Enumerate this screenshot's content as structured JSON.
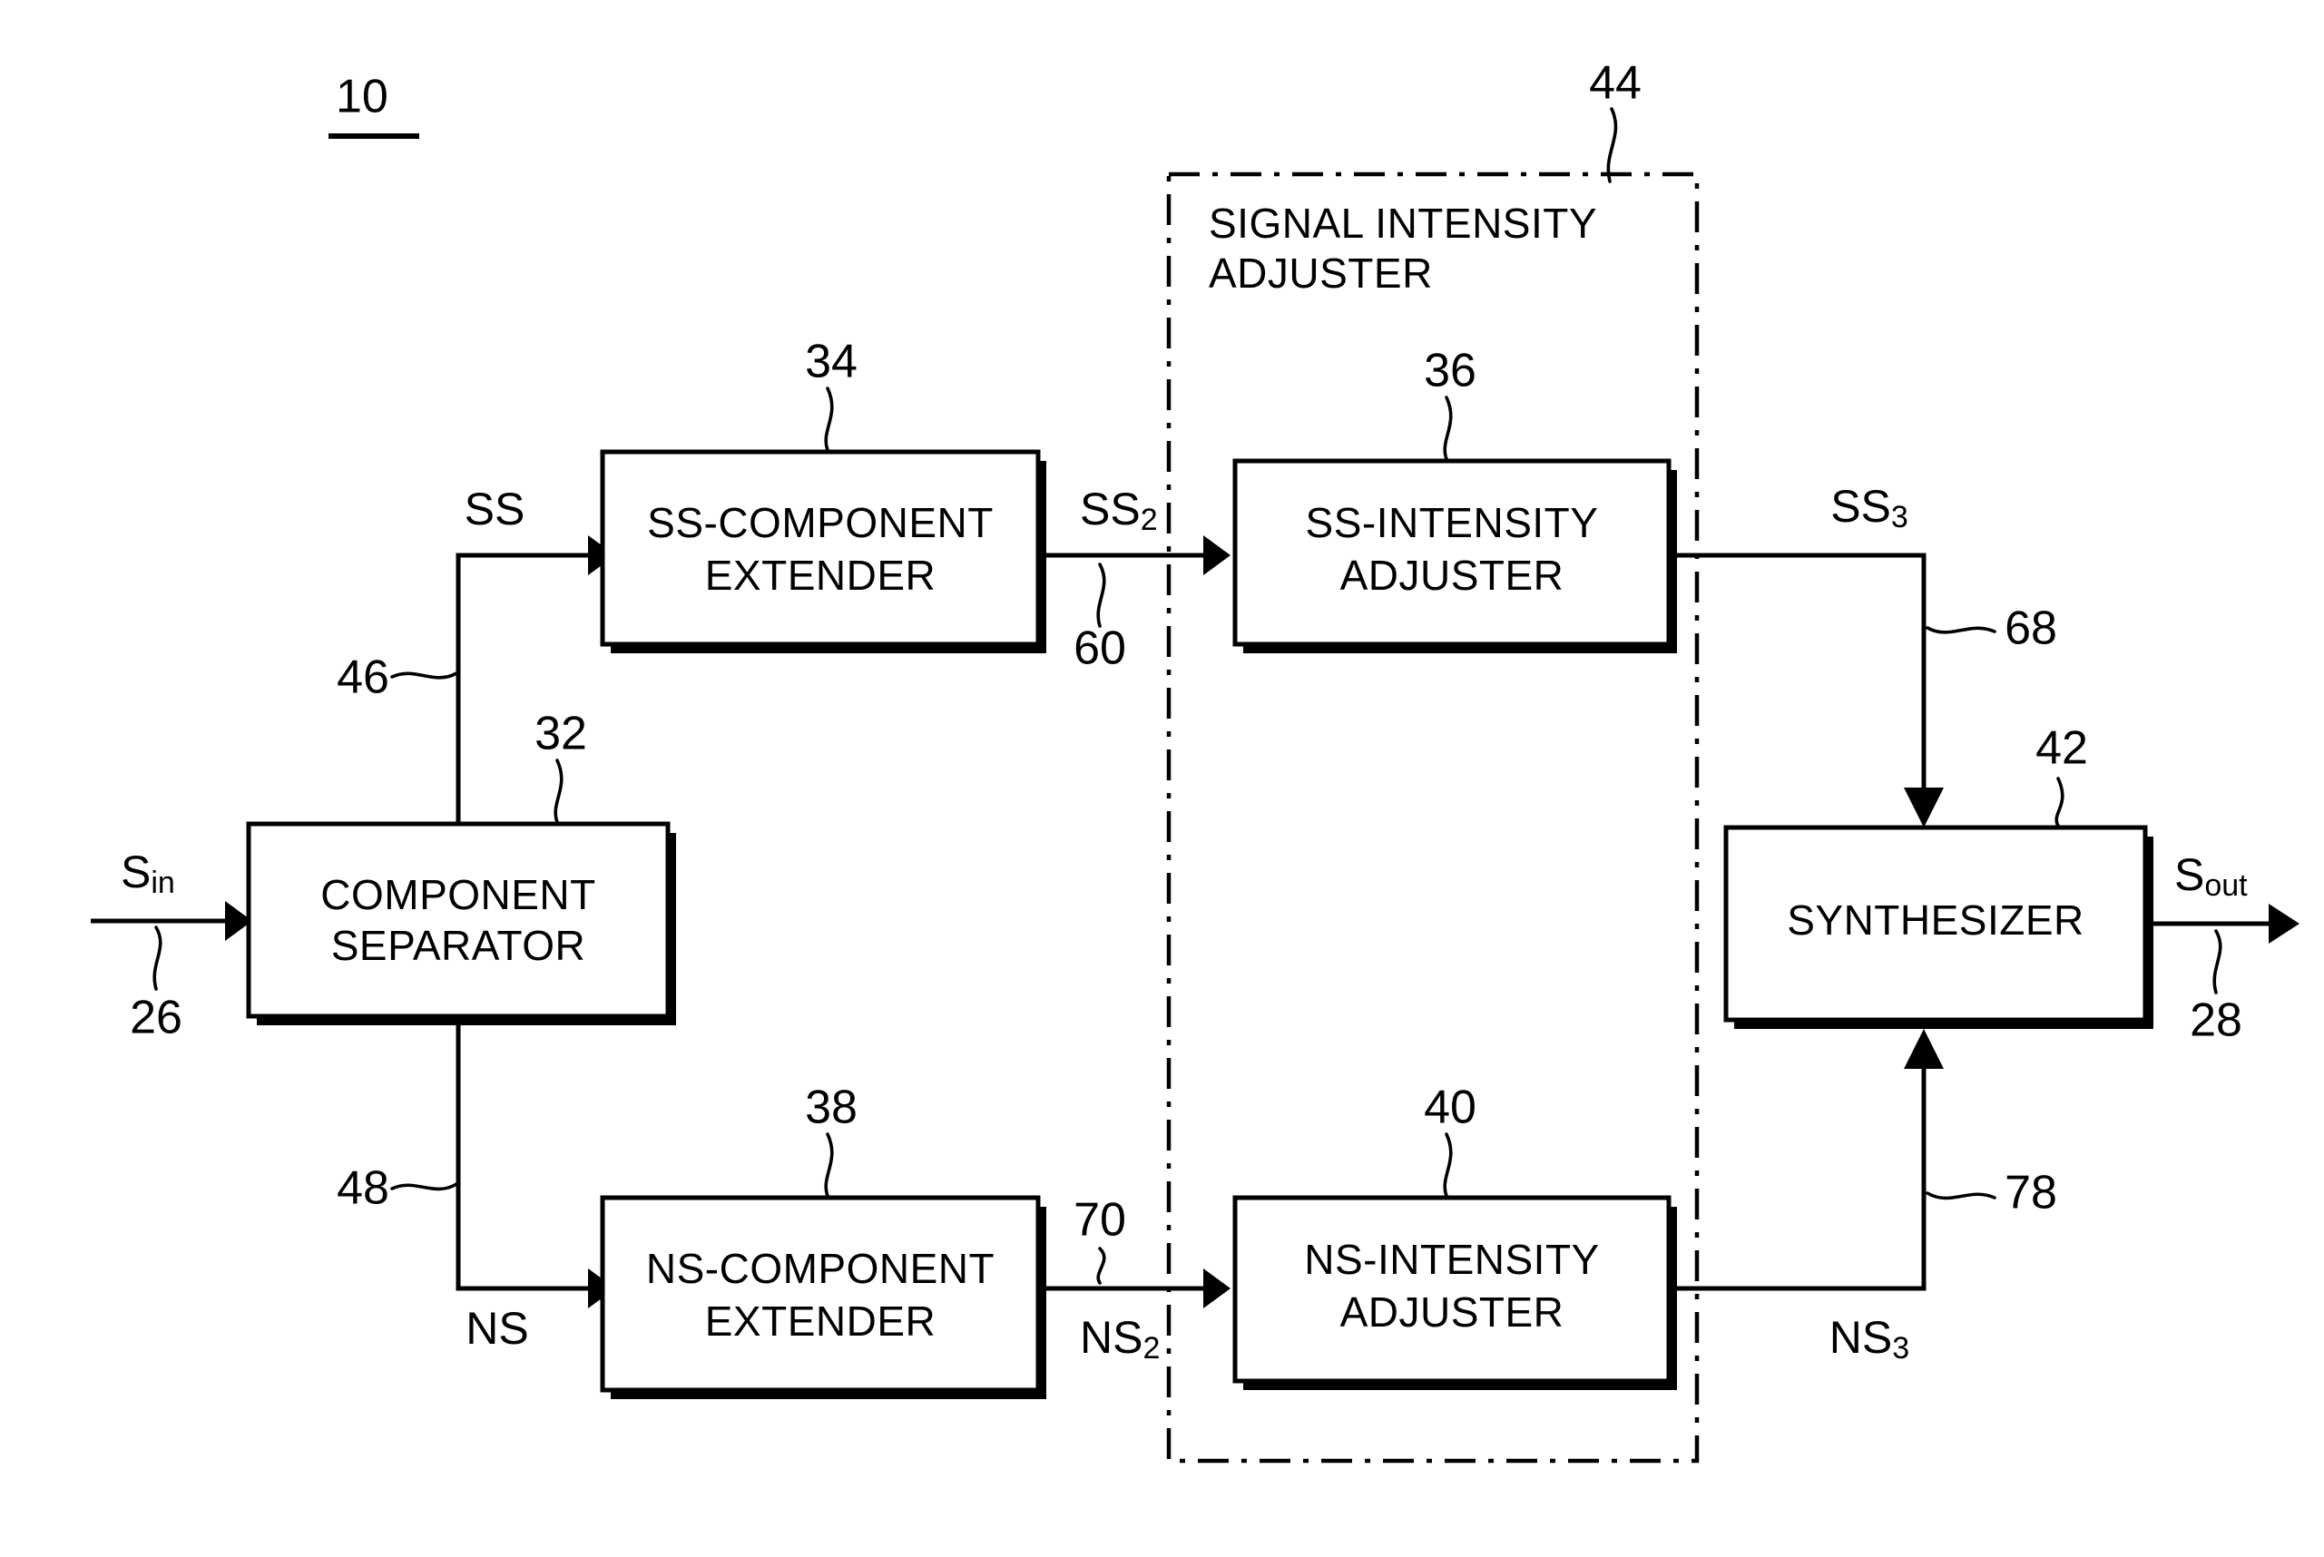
{
  "figure": {
    "number": "10",
    "underlined": true
  },
  "blocks": [
    {
      "id": "component-separator",
      "ref": "32",
      "lines": [
        "COMPONENT",
        "SEPARATOR"
      ]
    },
    {
      "id": "ss-component-extender",
      "ref": "34",
      "lines": [
        "SS-COMPONENT",
        "EXTENDER"
      ]
    },
    {
      "id": "ss-intensity-adjuster",
      "ref": "36",
      "lines": [
        "SS-INTENSITY",
        "ADJUSTER"
      ]
    },
    {
      "id": "ns-component-extender",
      "ref": "38",
      "lines": [
        "NS-COMPONENT",
        "EXTENDER"
      ]
    },
    {
      "id": "ns-intensity-adjuster",
      "ref": "40",
      "lines": [
        "NS-INTENSITY",
        "ADJUSTER"
      ]
    },
    {
      "id": "synthesizer",
      "ref": "42",
      "lines": [
        "SYNTHESIZER"
      ]
    }
  ],
  "group": {
    "id": "signal-intensity-adjuster",
    "ref": "44",
    "lines": [
      "SIGNAL INTENSITY",
      "ADJUSTER"
    ]
  },
  "signals": {
    "input": {
      "base": "S",
      "sub": "in"
    },
    "output": {
      "base": "S",
      "sub": "out"
    },
    "ss": "SS",
    "ns": "NS",
    "ss2": {
      "base": "SS",
      "sub": "2"
    },
    "ns2": {
      "base": "NS",
      "sub": "2"
    },
    "ss3": {
      "base": "SS",
      "sub": "3"
    },
    "ns3": {
      "base": "NS",
      "sub": "3"
    }
  },
  "line_refs": {
    "input_line": "26",
    "output_line": "28",
    "ss_branch": "46",
    "ns_branch": "48",
    "ss2_line": "60",
    "ns2_line": "70",
    "ss3_line": "68",
    "ns3_line": "78"
  },
  "colors": {
    "ink": "#000000",
    "paper": "#ffffff"
  }
}
